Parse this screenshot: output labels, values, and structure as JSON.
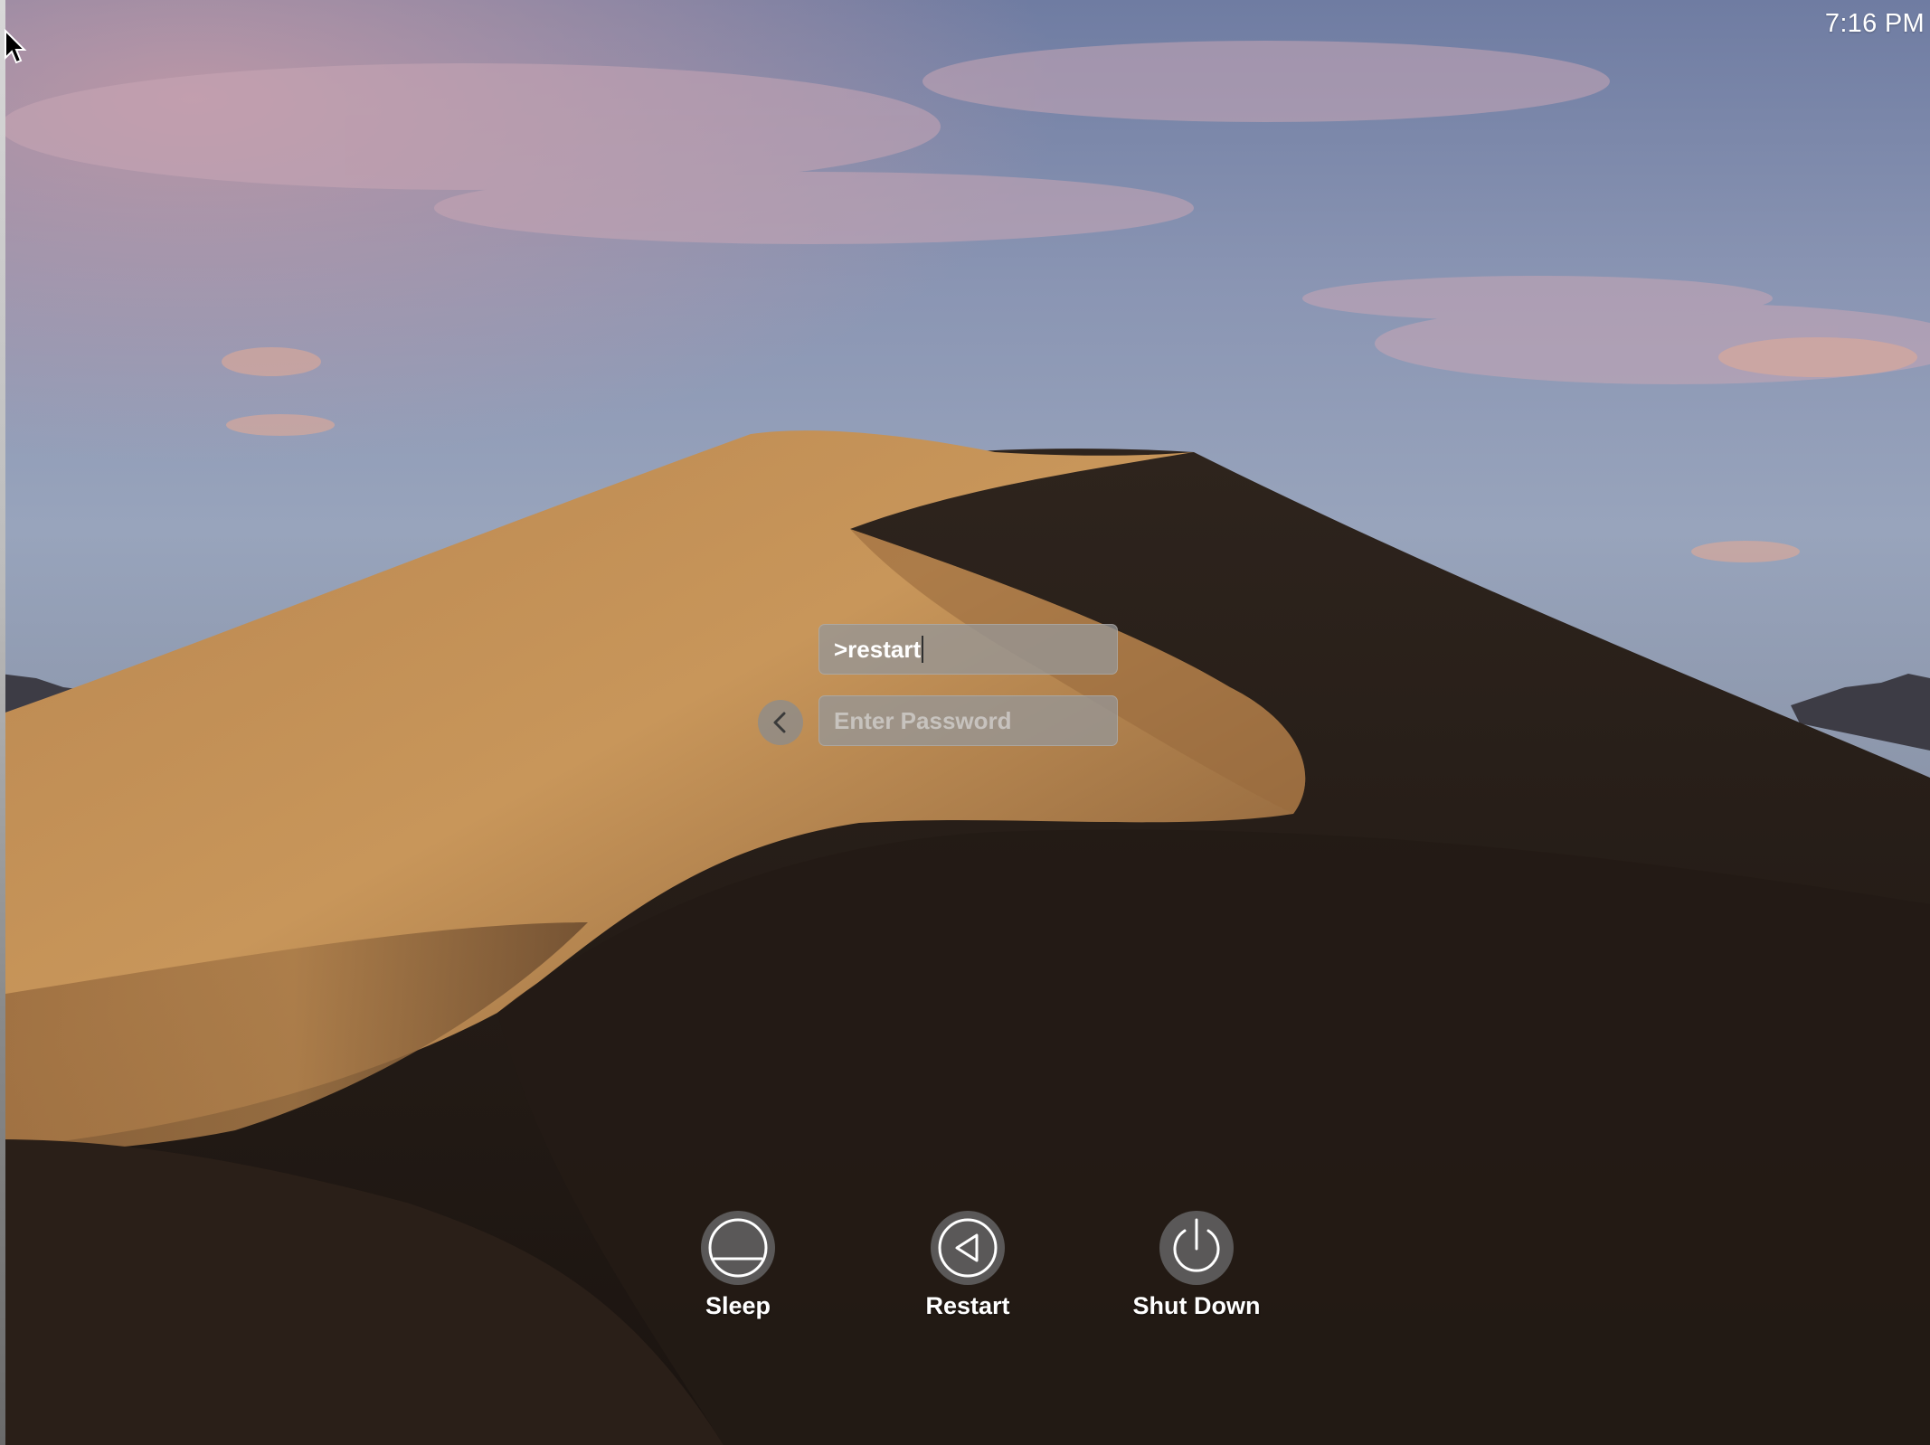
{
  "menubar": {
    "clock": "7:16 PM"
  },
  "login": {
    "username_value": ">restart",
    "password_placeholder": "Enter Password"
  },
  "power_options": [
    {
      "label": "Sleep",
      "icon": "sleep-icon"
    },
    {
      "label": "Restart",
      "icon": "restart-icon"
    },
    {
      "label": "Shut Down",
      "icon": "power-icon"
    }
  ],
  "wallpaper": {
    "name": "desert-dune",
    "colors": {
      "sky_top": "#6f7fa6",
      "sky_horizon": "#95a3bd",
      "sand_lit": "#c8965a",
      "sand_shadow": "#1e1611"
    }
  }
}
